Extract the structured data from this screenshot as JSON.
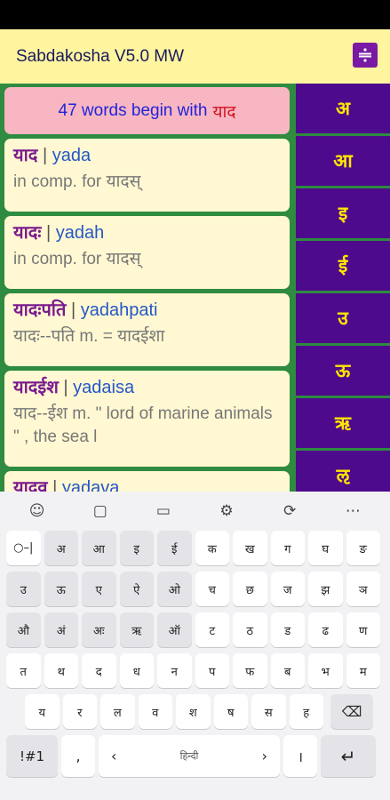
{
  "app": {
    "title": "Sabdakosha V5.0 MW"
  },
  "banner": {
    "prefix": "47 words begin with",
    "highlight": "याद"
  },
  "words": [
    {
      "deva": "याद",
      "roman": "yada",
      "def": "in comp. for यादस्"
    },
    {
      "deva": "यादः",
      "roman": "yadah",
      "def": "in comp. for यादस्"
    },
    {
      "deva": "यादःपति",
      "roman": "yadahpati",
      "def": "यादः--पति m. = यादईशा"
    },
    {
      "deva": "यादईश",
      "roman": "yadaisa",
      "def": "याद--ईश m. \" lord of marine animals \" , the sea l"
    },
    {
      "deva": "यादव",
      "roman": "yadava",
      "def": ""
    }
  ],
  "alphabet": [
    "अ",
    "आ",
    "इ",
    "ई",
    "उ",
    "ऊ",
    "ऋ",
    "ऌ"
  ],
  "keyboard": {
    "toolbar": [
      {
        "name": "emoji-icon",
        "glyph": "☺"
      },
      {
        "name": "sticker-icon",
        "glyph": "▢"
      },
      {
        "name": "gif-icon",
        "glyph": "▭"
      },
      {
        "name": "settings-gear-icon",
        "glyph": "⚙"
      },
      {
        "name": "translate-icon",
        "glyph": "⟳"
      },
      {
        "name": "more-icon",
        "glyph": "⋯"
      }
    ],
    "rows": [
      [
        "○–|",
        "अ",
        "आ",
        "इ",
        "ई",
        "क",
        "ख",
        "ग",
        "घ",
        "ङ"
      ],
      [
        "उ",
        "ऊ",
        "ए",
        "ऐ",
        "ओ",
        "च",
        "छ",
        "ज",
        "झ",
        "ञ"
      ],
      [
        "औ",
        "अं",
        "अः",
        "ऋ",
        "ऑ",
        "ट",
        "ठ",
        "ड",
        "ढ",
        "ण"
      ],
      [
        "त",
        "थ",
        "द",
        "ध",
        "न",
        "प",
        "फ",
        "ब",
        "भ",
        "म"
      ],
      [
        "य",
        "र",
        "ल",
        "व",
        "श",
        "ष",
        "स",
        "ह"
      ]
    ],
    "backspace": "⌫",
    "symbols": "!#1",
    "comma": ",",
    "space_left": "‹",
    "space_label": "हिन्दी",
    "space_right": "›",
    "danda": "।",
    "enter": "↵"
  }
}
